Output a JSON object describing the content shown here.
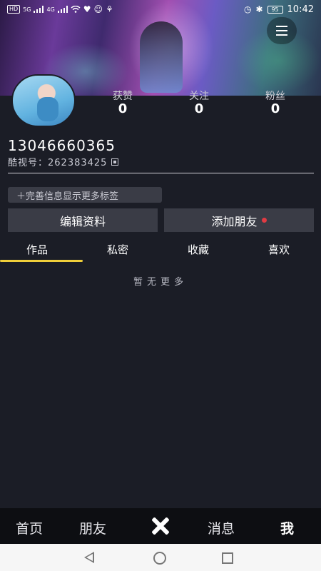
{
  "status_bar": {
    "left_chips": [
      "HD",
      "HD"
    ],
    "network_labels": [
      "5G",
      "4G"
    ],
    "battery": "95",
    "time": "10:42"
  },
  "profile": {
    "phone": "13046660365",
    "kuid_label": "酷视号：",
    "kuid_value": "262383425",
    "stats": [
      {
        "label": "获赞",
        "value": "0"
      },
      {
        "label": "关注",
        "value": "0"
      },
      {
        "label": "粉丝",
        "value": "0"
      }
    ]
  },
  "actions": {
    "tag_button": "＋完善信息显示更多标签",
    "edit_profile": "编辑资料",
    "add_friend": "添加朋友"
  },
  "tabs": [
    "作品",
    "私密",
    "收藏",
    "喜欢"
  ],
  "active_tab": 0,
  "empty_text": "暂无更多",
  "bottom_nav": {
    "home": "首页",
    "friends": "朋友",
    "messages": "消息",
    "me": "我"
  },
  "colors": {
    "background": "#1b1d26",
    "button_bg": "#3a3c46",
    "tab_indicator": "#f0cf3a",
    "notify_dot": "#e13b43"
  }
}
